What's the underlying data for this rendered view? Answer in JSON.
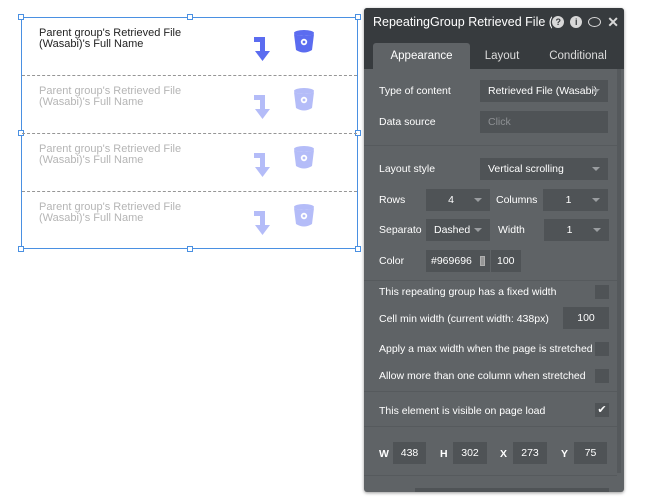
{
  "repeating_group": {
    "cells": [
      {
        "text": "Parent group's Retrieved File (Wasabi)'s Full Name",
        "line1": "Parent group's Retrieved File",
        "line2": "(Wasabi)'s Full Name",
        "faded": false
      },
      {
        "text": "Parent group's Retrieved File (Wasabi)'s Full Name",
        "line1": "Parent group's Retrieved File",
        "line2": "(Wasabi)'s Full Name",
        "faded": true
      },
      {
        "text": "Parent group's Retrieved File (Wasabi)'s Full Name",
        "line1": "Parent group's Retrieved File",
        "line2": "(Wasabi)'s Full Name",
        "faded": true
      },
      {
        "text": "Parent group's Retrieved File (Wasabi)'s Full Name",
        "line1": "Parent group's Retrieved File",
        "line2": "(Wasabi)'s Full Name",
        "faded": true
      }
    ],
    "icons": [
      "arrow-turn-down-icon",
      "bucket-icon"
    ],
    "icon_color": "#5b6cf0",
    "selection_color": "#4a90e2"
  },
  "panel": {
    "title": "RepeatingGroup Retrieved File (W",
    "header_icons": [
      "help-icon",
      "info-icon",
      "comment-icon",
      "close-icon"
    ],
    "tabs": [
      "Appearance",
      "Layout",
      "Conditional"
    ],
    "active_tab": "Appearance",
    "type_of_content": {
      "label": "Type of content",
      "value": "Retrieved File (Wasabi)"
    },
    "data_source": {
      "label": "Data source",
      "placeholder": "Click"
    },
    "layout_style": {
      "label": "Layout style",
      "value": "Vertical scrolling"
    },
    "rows": {
      "label": "Rows",
      "value": "4"
    },
    "columns": {
      "label": "Columns",
      "value": "1"
    },
    "separator": {
      "label": "Separato",
      "value": "Dashed"
    },
    "width": {
      "label": "Width",
      "value": "1"
    },
    "color": {
      "label": "Color",
      "value": "#969696",
      "opacity": "100"
    },
    "fixed_width": {
      "label": "This repeating group has a fixed width",
      "checked": false
    },
    "cell_min_width": {
      "label": "Cell min width (current width: 438px)",
      "value": "100"
    },
    "max_width": {
      "label": "Apply a max width when the page is stretched",
      "checked": false
    },
    "multi_column": {
      "label": "Allow more than one column when stretched",
      "checked": false
    },
    "visible_on_load": {
      "label": "This element is visible on page load",
      "checked": true
    },
    "geometry": {
      "w_label": "W",
      "w": "438",
      "h_label": "H",
      "h": "302",
      "x_label": "X",
      "x": "273",
      "y_label": "Y",
      "y": "75"
    }
  }
}
